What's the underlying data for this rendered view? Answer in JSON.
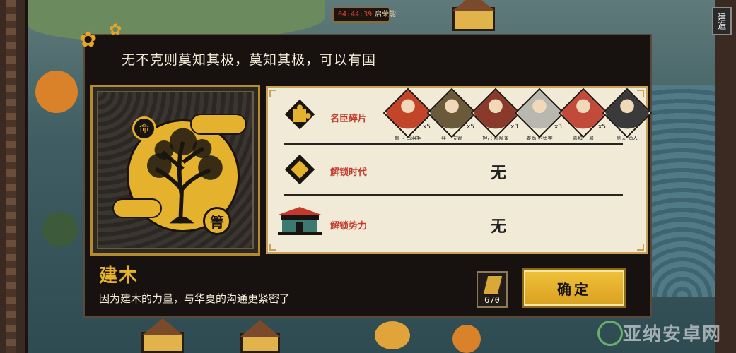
{
  "topbar": {
    "timer": "04:44:39",
    "timer_label": "启荣能"
  },
  "side_tab": {
    "label": "建造"
  },
  "watermark": {
    "text": "亚纳安卓网"
  },
  "modal": {
    "title": "无不克则莫知其极，莫知其极，可以有国",
    "emblem": {
      "badge_top": "命",
      "badge_bottom": "箐"
    },
    "rows": {
      "fragments": {
        "label": "名臣碎片",
        "items": [
          {
            "name": "帐卫·鸟羽毛",
            "count": "x5",
            "color": "#c2452a"
          },
          {
            "name": "羿·一支箭",
            "count": "x5",
            "color": "#6a5a3a"
          },
          {
            "name": "妲己·那隐雀",
            "count": "x3",
            "color": "#8a3a2a"
          },
          {
            "name": "姜尚·钓鱼竿",
            "count": "x3",
            "color": "#b8b8b0"
          },
          {
            "name": "喜和·日晷",
            "count": "x5",
            "color": "#c24a3a"
          },
          {
            "name": "刑天·俑人",
            "count": "",
            "color": "#3a3a3a"
          }
        ]
      },
      "era": {
        "label": "解锁时代",
        "value": "无"
      },
      "faction": {
        "label": "解锁势力",
        "value": "无"
      }
    },
    "hero": {
      "name": "建木",
      "description": "因为建木的力量，与华夏的沟通更紧密了"
    },
    "resource": {
      "count": "670"
    },
    "confirm_label": "确定"
  }
}
